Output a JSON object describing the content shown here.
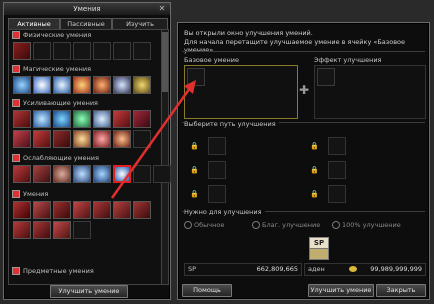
{
  "skills_window": {
    "title": "Умения",
    "tabs": [
      "Активные",
      "Пассивные",
      "Изучить умение"
    ],
    "sections": [
      {
        "label": "Физические умения"
      },
      {
        "label": "Магические умения"
      },
      {
        "label": "Усиливающие умения"
      },
      {
        "label": "Ослабляющие умения"
      },
      {
        "label": "Умения"
      },
      {
        "label": "Предметные умения"
      }
    ],
    "learn_button": "Улучшить умение"
  },
  "enhance_window": {
    "info_line1": "Вы открыли окно улучшения умений.",
    "info_line2": "Для начала перетащите улучшаемое умение в ячейку «Базовое умение».",
    "base_skill_label": "Базовое умение",
    "effect_label": "Эффект улучшения",
    "path_label": "Выберите путь улучшения",
    "needed_label": "Нужно для улучшения",
    "radio_normal": "Обычное",
    "radio_blessed": "Благ. улучшение",
    "radio_100": "100% улучшение",
    "sp_label": "SP",
    "sp_value": "662,809,665",
    "adena_label": "аден",
    "adena_value": "99,989,999,999",
    "help_button": "Помощь",
    "enhance_button": "Улучшить умение",
    "close_button": "Закрыть"
  },
  "colors": {
    "accent_red": "#e03030",
    "frame": "#6b6b6b",
    "highlight": "#d22"
  }
}
